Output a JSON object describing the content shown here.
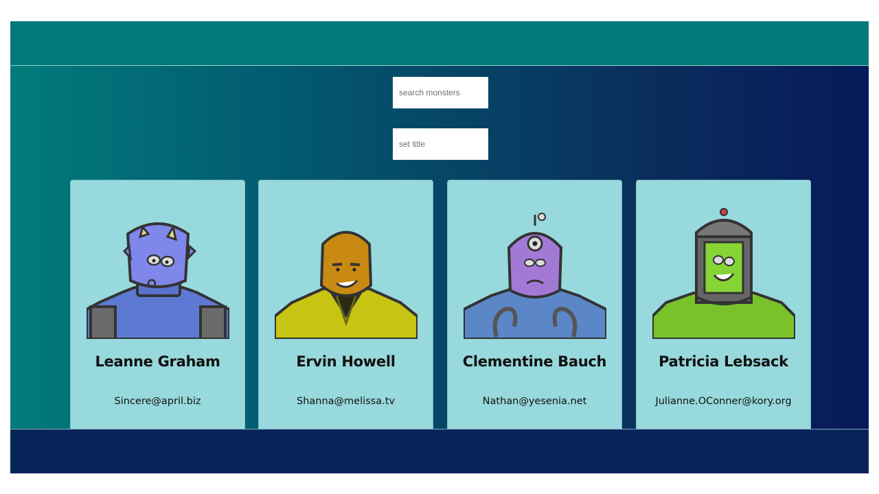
{
  "search": {
    "placeholder": "search monsters"
  },
  "title_field": {
    "placeholder": "set title"
  },
  "monsters": [
    {
      "name": "Leanne Graham",
      "email": "Sincere@april.biz",
      "icon": "blue-monster-icon"
    },
    {
      "name": "Ervin Howell",
      "email": "Shanna@melissa.tv",
      "icon": "orange-monster-icon"
    },
    {
      "name": "Clementine Bauch",
      "email": "Nathan@yesenia.net",
      "icon": "purple-monster-icon"
    },
    {
      "name": "Patricia Lebsack",
      "email": "Julianne.OConner@kory.org",
      "icon": "green-monster-icon"
    }
  ],
  "colors": {
    "card": "#97d9dc",
    "header": "#027a7a",
    "footer": "#08255a"
  }
}
